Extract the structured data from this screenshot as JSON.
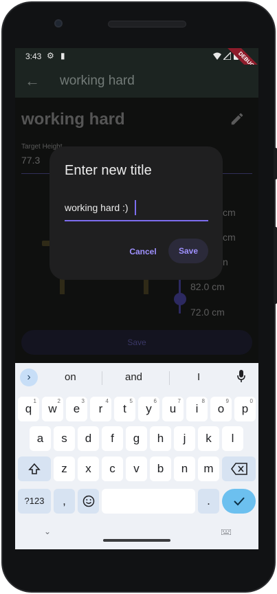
{
  "status_bar": {
    "time": "3:43",
    "debug_label": "DEBUG"
  },
  "app_bar": {
    "title": "working hard",
    "back_icon": "arrow-back-icon"
  },
  "page": {
    "title": "working hard",
    "edit_icon": "pencil-icon",
    "target_label": "Target Height",
    "target_value": "77.3",
    "scale_labels": [
      "cm",
      "cm",
      "n",
      "82.0 cm",
      "72.0 cm"
    ],
    "save_label": "Save"
  },
  "dialog": {
    "title": "Enter new title",
    "input_value": "working hard :)",
    "cancel_label": "Cancel",
    "save_label": "Save"
  },
  "keyboard": {
    "suggestions": [
      "on",
      "and",
      "I"
    ],
    "rows": [
      [
        "q",
        "w",
        "e",
        "r",
        "t",
        "y",
        "u",
        "i",
        "o",
        "p"
      ],
      [
        "a",
        "s",
        "d",
        "f",
        "g",
        "h",
        "j",
        "k",
        "l"
      ],
      [
        "z",
        "x",
        "c",
        "v",
        "b",
        "n",
        "m"
      ]
    ],
    "digit_hints": [
      "1",
      "2",
      "3",
      "4",
      "5",
      "6",
      "7",
      "8",
      "9",
      "0"
    ],
    "symbols_label": "?123",
    "comma": ",",
    "period": "."
  },
  "colors": {
    "accent": "#7d6ef0",
    "action_key": "#6cc0ef",
    "debug": "#8e1c2b"
  }
}
